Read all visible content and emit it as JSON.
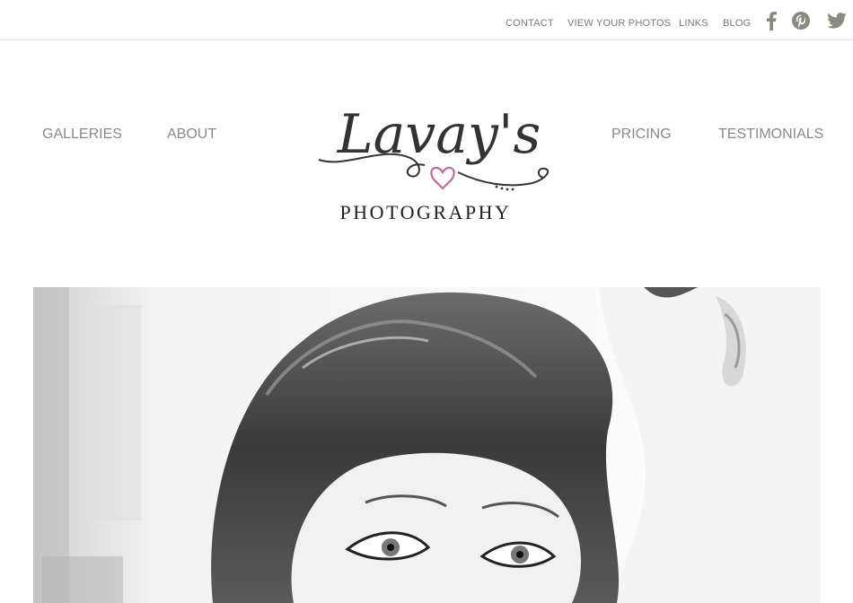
{
  "utility_nav": {
    "contact": "CONTACT",
    "view_photos": "VIEW YOUR PHOTOS",
    "links": "LINKS",
    "blog": "BLOG"
  },
  "social": {
    "facebook_icon": "facebook-icon",
    "pinterest_icon": "pinterest-icon",
    "twitter_icon": "twitter-icon"
  },
  "main_nav": {
    "galleries": "GALLERIES",
    "about": "ABOUT",
    "pricing": "PRICING",
    "testimonials": "TESTIMONIALS"
  },
  "logo": {
    "script": "Lavay's",
    "subtitle": "PHOTOGRAPHY"
  },
  "colors": {
    "nav_text": "#8a8a80",
    "util_text": "#7a7a7a",
    "logo_text": "#333333",
    "heart_accent": "#c2679f"
  }
}
